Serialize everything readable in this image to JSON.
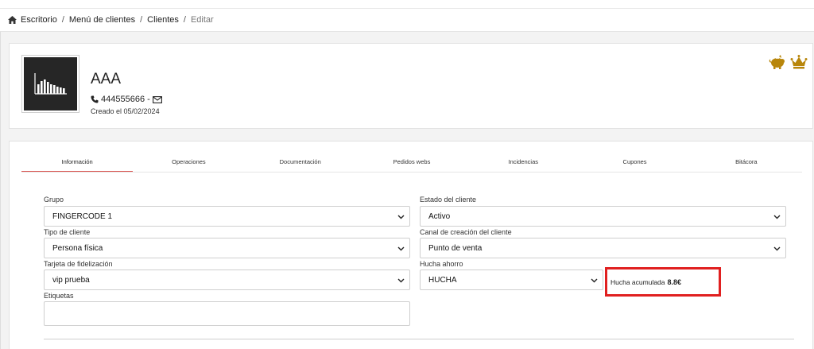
{
  "breadcrumb": {
    "items": [
      "Escritorio",
      "Menú de clientes",
      "Clientes",
      "Editar"
    ]
  },
  "client": {
    "name": "AAA",
    "phone": "444555666",
    "dash": "-",
    "created": "Creado el 05/02/2024"
  },
  "tabs": [
    {
      "label": "Información",
      "active": true
    },
    {
      "label": "Operaciones"
    },
    {
      "label": "Documentación"
    },
    {
      "label": "Pedidos webs"
    },
    {
      "label": "Incidencias"
    },
    {
      "label": "Cupones"
    },
    {
      "label": "Bitácora"
    }
  ],
  "form": {
    "grupo": {
      "label": "Grupo",
      "value": "FINGERCODE 1"
    },
    "estado": {
      "label": "Estado del cliente",
      "value": "Activo"
    },
    "tipo": {
      "label": "Tipo de cliente",
      "value": "Persona física"
    },
    "canal": {
      "label": "Canal de creación del cliente",
      "value": "Punto de venta"
    },
    "tarjeta": {
      "label": "Tarjeta de fidelización",
      "value": "vip prueba"
    },
    "hucha": {
      "label": "Hucha ahorro",
      "value": "HUCHA"
    },
    "hucha_acumulada": {
      "label": "Hucha acumulada",
      "value": "8.8€"
    },
    "etiquetas": {
      "label": "Etiquetas",
      "value": ""
    }
  },
  "colors": {
    "accent": "#b8860b",
    "tab_active": "#d9534f",
    "highlight": "#e02020"
  },
  "icons": [
    "home-icon",
    "phone-icon",
    "envelope-icon",
    "piggy-bank-icon",
    "crown-icon",
    "chevron-down-icon"
  ]
}
